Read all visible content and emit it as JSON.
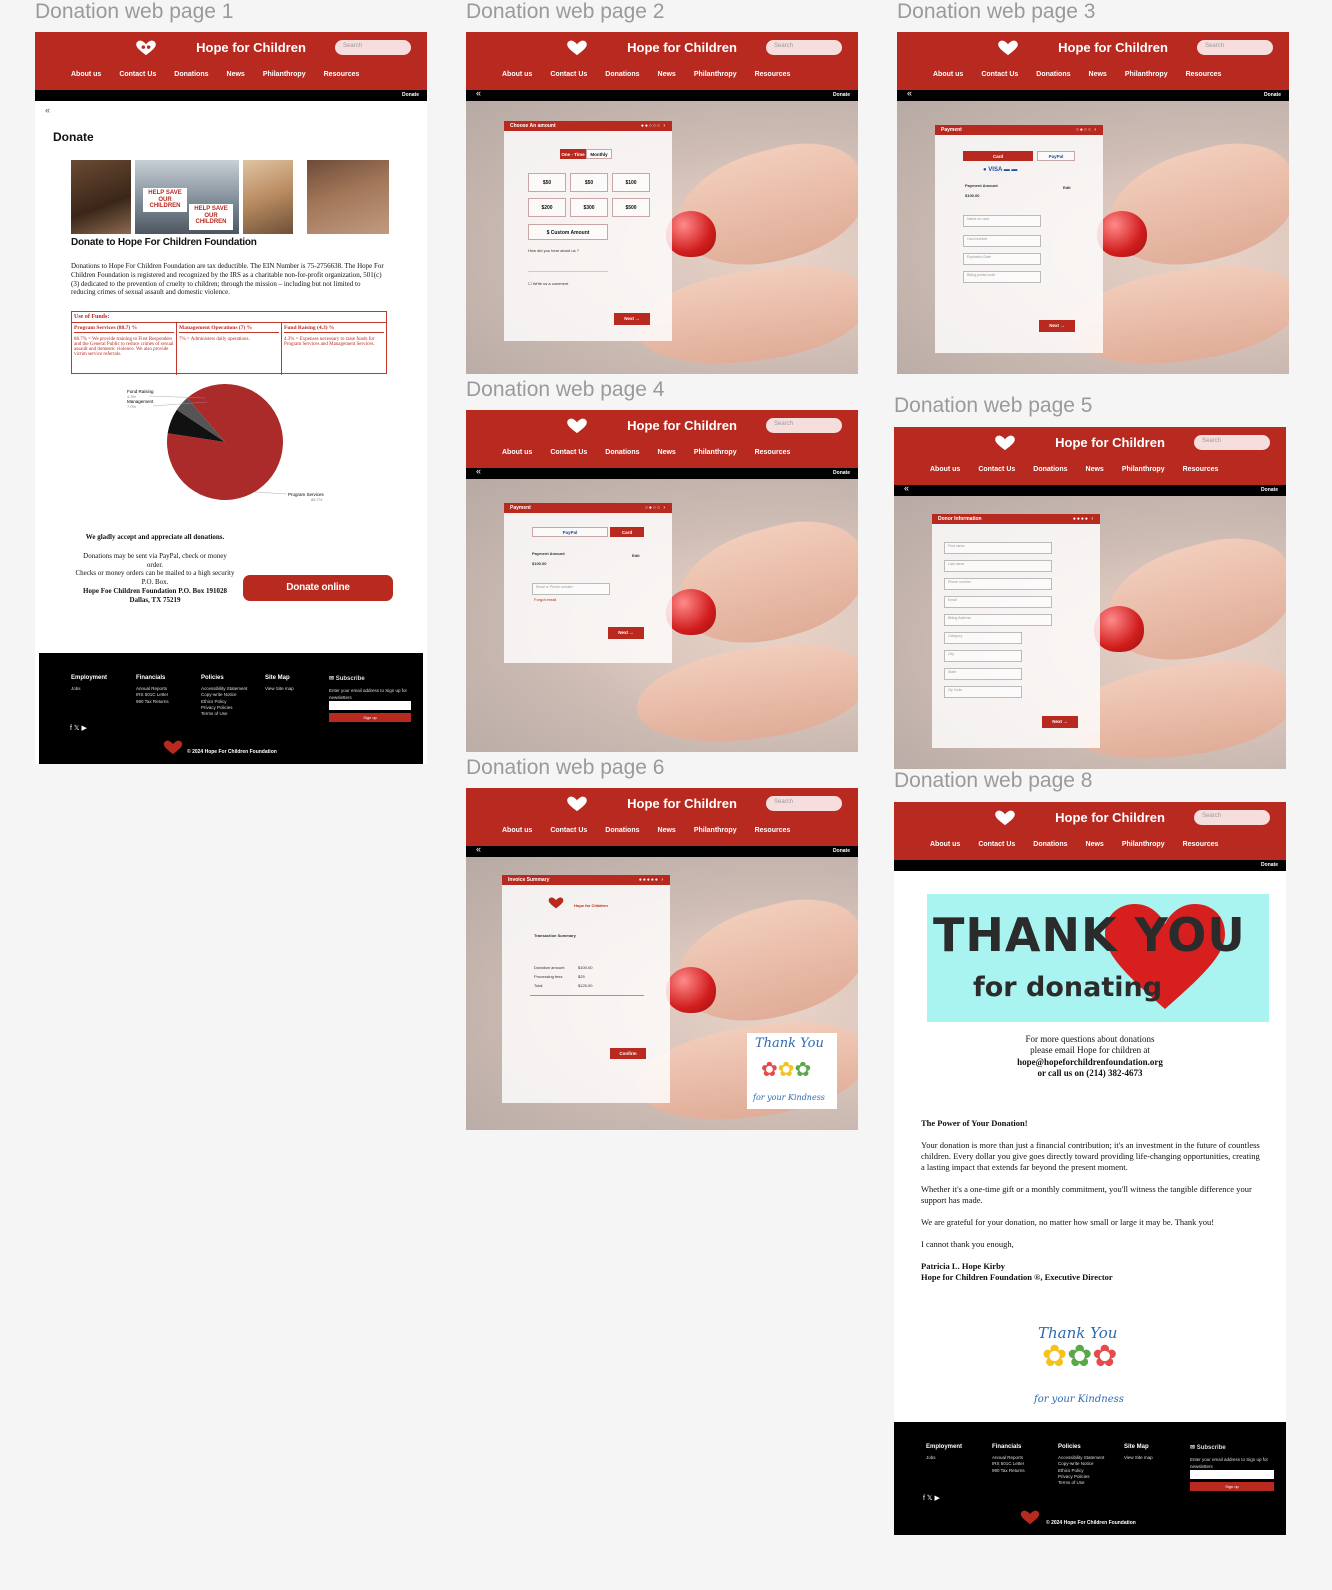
{
  "frames": {
    "p1": "Donation web page 1",
    "p2": "Donation web page 2",
    "p3": "Donation web page 3",
    "p4": "Donation web page 4",
    "p5": "Donation web page 5",
    "p6": "Donation web page 6",
    "p8": "Donation web page 8"
  },
  "header": {
    "brand": "Hope for Children",
    "search_placeholder": "Search",
    "nav": [
      "About us",
      "Contact Us",
      "Donations",
      "News",
      "Philanthropy",
      "Resources"
    ],
    "sub_donate": "Donate"
  },
  "colors": {
    "brand_red": "#b82a20",
    "black": "#000000",
    "thank_you_bg": "#a9f3f1"
  },
  "page1": {
    "title": "Donate",
    "photo_sign": "HELP SAVE OUR CHILDREN",
    "heading": "Donate to Hope For Children Foundation",
    "paragraph": "Donations to Hope For Children Foundation are tax deductible. The EIN Number is 75-2756638. The Hope For Children Foundation is registered and recognized by the IRS as a charitable non-for-profit organization, 501(c)(3) dedicated to the prevention of cruelty to children; through the mission – including but not limited to reducing crimes of sexual assault and domestic violence.",
    "funds_header": "Use of Funds:",
    "funds": [
      {
        "title": "Program Services (88.7) %",
        "text": "88.7% = We provide training to First Responders and the General Public to reduce crimes of sexual assault and domestic violence. We also provide victim service referrals."
      },
      {
        "title": "Management Operations (7) %",
        "text": "7% = Administers daily operations."
      },
      {
        "title": "Fund Raising (4.3) %",
        "text": "4.3% = Expenses necessary to raise funds for Program Services and Management Services."
      }
    ],
    "pie_labels": {
      "fund": "Fund Raising",
      "fund_pct": "4.3%",
      "mgmt": "Management",
      "mgmt_pct": "7.0%",
      "prog": "Program Services",
      "prog_pct": "88.7%"
    },
    "accept_title": "We gladly accept and appreciate all donations.",
    "accept_lines": [
      "Donations may be sent via PayPal, check or money order.",
      "Checks or money orders can be mailed to a high security P.O. Box.",
      "Hope Foe Children Foundation P.O. Box 191028 Dallas, TX 75219"
    ],
    "donate_button": "Donate online"
  },
  "chart_data": {
    "type": "pie",
    "categories": [
      "Program Services",
      "Management",
      "Fund Raising"
    ],
    "values": [
      88.7,
      7.0,
      4.3
    ],
    "colors": [
      "#ab2a2a",
      "#111111",
      "#555555"
    ]
  },
  "page2": {
    "panel_title": "Choose An amount",
    "one_time": "One - Time",
    "monthly": "Monthly",
    "amounts": [
      "$50",
      "$50",
      "$100",
      "$200",
      "$300",
      "$500"
    ],
    "custom": "$ Custom Amount",
    "heard": "How did you hear about us ?",
    "comment": "Write us a comment",
    "next": "Next"
  },
  "page3": {
    "panel_title": "Payment",
    "card": "Card",
    "paypal": "PayPal",
    "payment_amount": "Payment Amount",
    "amount": "$100.00",
    "edit": "Edit",
    "fields": [
      "Name on card",
      "Card number",
      "Expiration Date",
      "Billing postal code"
    ],
    "next": "Next"
  },
  "page4": {
    "panel_title": "Payment",
    "paypal": "PayPal",
    "card": "Card",
    "payment_amount": "Payment Amount",
    "amount": "$100.00",
    "edit": "Edit",
    "email_field": "Email or Phone number",
    "forgot": "Forgot email",
    "next": "Next"
  },
  "page5": {
    "panel_title": "Donor Information",
    "fields": [
      "First name",
      "Last name",
      "Phone number",
      "Email",
      "Billing Address",
      "Category",
      "City",
      "State",
      "Zip Code"
    ],
    "next": "Next"
  },
  "page6": {
    "panel_title": "Invoice Summary",
    "brand": "Hope for Children",
    "summary_title": "Transaction Summary",
    "rows": [
      [
        "Donation amount",
        "$100.00"
      ],
      [
        "Processing fees",
        "$25"
      ],
      [
        "Total",
        "$125.00"
      ]
    ],
    "confirm": "Confirm"
  },
  "page8": {
    "thank": "THANK YOU",
    "for_donating": "for donating",
    "contact_lines": [
      "For more questions about donations",
      "please email Hope for children at"
    ],
    "email": "hope@hopeforchildrenfoundation.org",
    "phone": "or call us on (214) 382-4673",
    "story_title": "The Power of Your Donation!",
    "story": [
      "Your donation is more than just a financial contribution; it's an investment in the future of countless children. Every dollar you give goes directly toward providing life-changing opportunities, creating a lasting impact that extends far beyond the present moment.",
      "Whether it's a one-time gift or a monthly commitment, you'll witness the tangible difference your support has made.",
      "We are grateful for your donation, no matter how small or large it may be. Thank you!",
      "I cannot thank you enough,"
    ],
    "signature_name": "Patricia L. Hope Kirby",
    "signature_title": "Hope for Children Foundation ®, Executive Director",
    "ty_card_1": "Thank You",
    "ty_card_2": "for your Kindness"
  },
  "footer": {
    "employment": "Employment",
    "jobs": "Jobs",
    "financials": "Financials",
    "fin_items": [
      "Annual Reports",
      "IRS 501C Letter",
      "990 Tax Returns"
    ],
    "policies": "Policies",
    "pol_items": [
      "Accessibility Statement",
      "Copy-write Notice",
      "Ethics Policy",
      "Privacy Policies",
      "Terms of Use"
    ],
    "sitemap": "Site Map",
    "sitemap_item": "View Site map",
    "subscribe": "Subscribe",
    "subscribe_text": "Enter your email address to Sign up for newsletters",
    "signup": "Sign up",
    "copyright": "© 2024 Hope For Children Foundation"
  }
}
